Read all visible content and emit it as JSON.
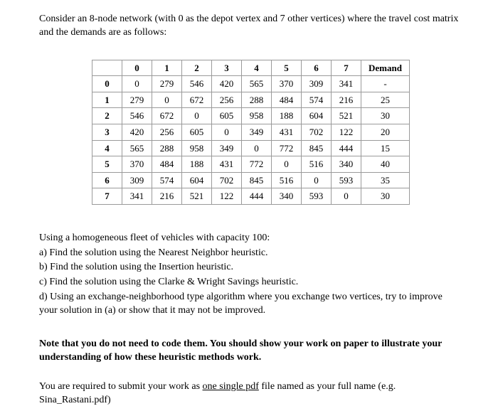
{
  "intro": "Consider an 8-node network (with 0 as the depot vertex and 7 other vertices) where the travel cost matrix and the demands are as follows:",
  "table": {
    "col_headers": [
      "",
      "0",
      "1",
      "2",
      "3",
      "4",
      "5",
      "6",
      "7",
      "Demand"
    ],
    "rows": [
      {
        "label": "0",
        "cells": [
          "0",
          "279",
          "546",
          "420",
          "565",
          "370",
          "309",
          "341"
        ],
        "demand": "-"
      },
      {
        "label": "1",
        "cells": [
          "279",
          "0",
          "672",
          "256",
          "288",
          "484",
          "574",
          "216"
        ],
        "demand": "25"
      },
      {
        "label": "2",
        "cells": [
          "546",
          "672",
          "0",
          "605",
          "958",
          "188",
          "604",
          "521"
        ],
        "demand": "30"
      },
      {
        "label": "3",
        "cells": [
          "420",
          "256",
          "605",
          "0",
          "349",
          "431",
          "702",
          "122"
        ],
        "demand": "20"
      },
      {
        "label": "4",
        "cells": [
          "565",
          "288",
          "958",
          "349",
          "0",
          "772",
          "845",
          "444"
        ],
        "demand": "15"
      },
      {
        "label": "5",
        "cells": [
          "370",
          "484",
          "188",
          "431",
          "772",
          "0",
          "516",
          "340"
        ],
        "demand": "40"
      },
      {
        "label": "6",
        "cells": [
          "309",
          "574",
          "604",
          "702",
          "845",
          "516",
          "0",
          "593"
        ],
        "demand": "35"
      },
      {
        "label": "7",
        "cells": [
          "341",
          "216",
          "521",
          "122",
          "444",
          "340",
          "593",
          "0"
        ],
        "demand": "30"
      }
    ]
  },
  "instructions": {
    "lead_prefix": " Using a homogeneous fleet of vehicles with capacity 100:",
    "a": "a) Find the solution using the Nearest Neighbor heuristic.",
    "b": "b) Find the solution using the Insertion heuristic.",
    "c": "c) Find the solution using the Clarke & Wright Savings heuristic.",
    "d": "d) Using an exchange-neighborhood type algorithm where you exchange two vertices, try to improve your solution in (a) or show that it may not be improved."
  },
  "note": "Note that you do not need to code them. You should show your work on paper to illustrate your understanding of how these heuristic methods work.",
  "submit": {
    "before": "You are required to submit your work as ",
    "underlined": "one single pdf",
    "after": " file named as your full name (e.g. Sina_Rastani.pdf)"
  },
  "chart_data": {
    "type": "table",
    "title": "Travel cost matrix and demands for 8-node network (0 is depot)",
    "nodes": [
      0,
      1,
      2,
      3,
      4,
      5,
      6,
      7
    ],
    "cost_matrix": [
      [
        0,
        279,
        546,
        420,
        565,
        370,
        309,
        341
      ],
      [
        279,
        0,
        672,
        256,
        288,
        484,
        574,
        216
      ],
      [
        546,
        672,
        0,
        605,
        958,
        188,
        604,
        521
      ],
      [
        420,
        256,
        605,
        0,
        349,
        431,
        702,
        122
      ],
      [
        565,
        288,
        958,
        349,
        0,
        772,
        845,
        444
      ],
      [
        370,
        484,
        188,
        431,
        772,
        0,
        516,
        340
      ],
      [
        309,
        574,
        604,
        702,
        845,
        516,
        0,
        593
      ],
      [
        341,
        216,
        521,
        122,
        444,
        340,
        593,
        0
      ]
    ],
    "demands": [
      null,
      25,
      30,
      20,
      15,
      40,
      35,
      30
    ],
    "vehicle_capacity": 100
  }
}
